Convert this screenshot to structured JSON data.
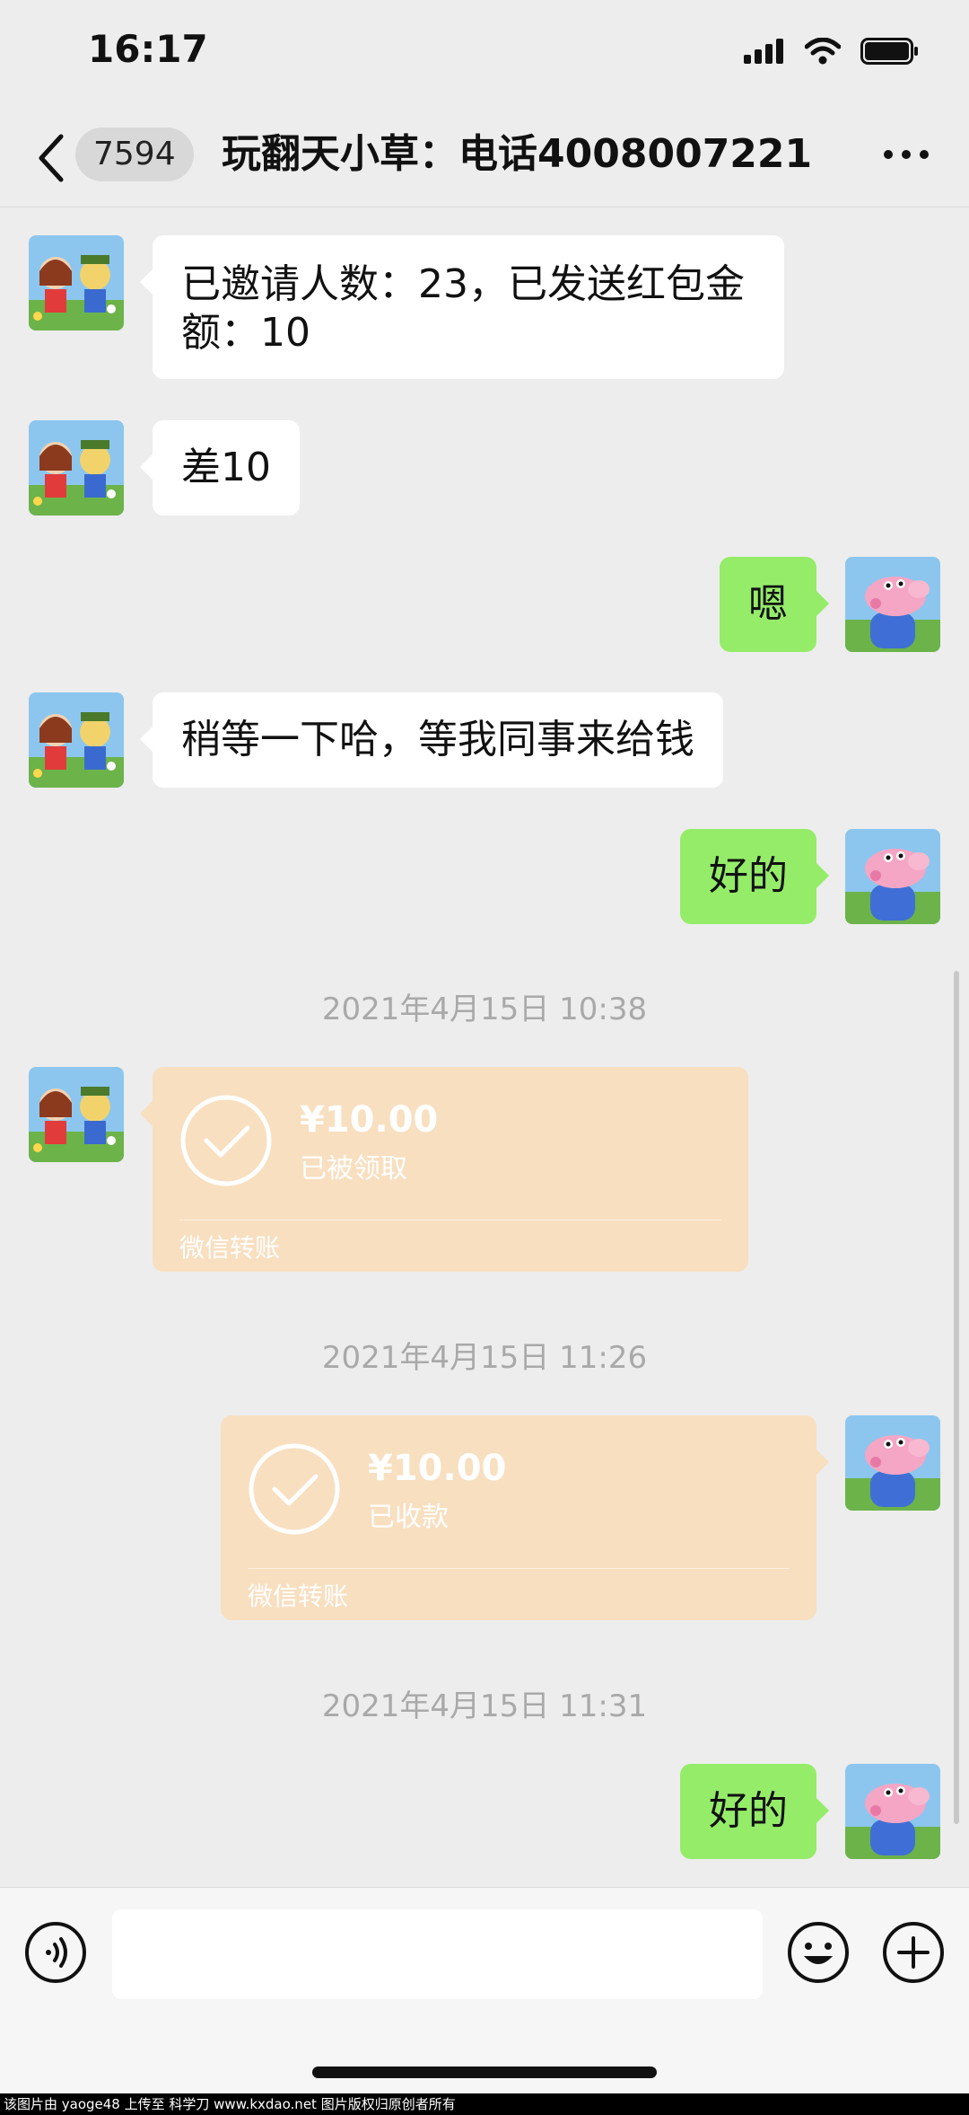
{
  "status_bar": {
    "time": "16:17"
  },
  "nav": {
    "unread_count": "7594",
    "title": "玩翻天小草：电话4008007221"
  },
  "messages": [
    {
      "type": "text",
      "side": "in",
      "text": "已邀请人数：23，已发送红包金\n额：10"
    },
    {
      "type": "text",
      "side": "in",
      "text": "差10"
    },
    {
      "type": "text",
      "side": "out",
      "text": "嗯"
    },
    {
      "type": "text",
      "side": "in",
      "text": "稍等一下哈，等我同事来给钱"
    },
    {
      "type": "text",
      "side": "out",
      "text": "好的"
    },
    {
      "type": "time",
      "text": "2021年4月15日 10:38"
    },
    {
      "type": "transfer",
      "side": "in",
      "amount": "¥10.00",
      "status": "已被领取",
      "label": "微信转账"
    },
    {
      "type": "time",
      "text": "2021年4月15日 11:26"
    },
    {
      "type": "transfer",
      "side": "out",
      "amount": "¥10.00",
      "status": "已收款",
      "label": "微信转账"
    },
    {
      "type": "time",
      "text": "2021年4月15日 11:31"
    },
    {
      "type": "text",
      "side": "out",
      "text": "好的"
    }
  ],
  "watermark": "该图片由 yaoge48 上传至 科学刀 www.kxdao.net 图片版权归原创者所有",
  "colors": {
    "background": "#ededed",
    "bubble_out": "#95ec69",
    "bubble_in": "#ffffff",
    "transfer": "#f8dfc0"
  }
}
